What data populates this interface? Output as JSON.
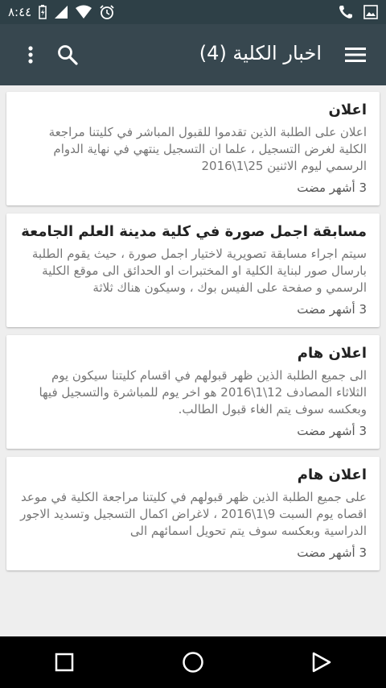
{
  "status_bar": {
    "time": "٨:٤٤",
    "icons": [
      "battery-icon",
      "signal-icon",
      "wifi-icon",
      "alarm-icon",
      "phone-icon",
      "image-icon"
    ]
  },
  "app_bar": {
    "title": "اخبار الكلية (4)",
    "icons": [
      "more-vert-icon",
      "search-icon",
      "hamburger-menu-icon"
    ]
  },
  "news": [
    {
      "title": "اعلان",
      "body": "اعلان على الطلبة الذين تقدموا للقبول المباشر في كليتنا مراجعة الكلية لغرض التسجيل ، علما ان التسجيل ينتهي في نهاية الدوام الرسمي ليوم الاثنين 25\\1\\2016",
      "time": "3 أشهر مضت"
    },
    {
      "title": "مسابقة اجمل صورة في كلية مدينة العلم الجامعة",
      "body": "سيتم اجراء مسابقة تصويرية لاختيار اجمل صورة ، حيث يقوم الطلبة بارسال صور لبناية الكلية او المختبرات او الحدائق الى موقع الكلية الرسمي و صفحة على الفيس بوك ، وسيكون هناك ثلاثة",
      "time": "3 أشهر مضت"
    },
    {
      "title": "اعلان هام",
      "body": "الى جميع الطلبة الذين ظهر قبولهم في اقسام كليتنا سيكون يوم الثلاثاء المصادف 12\\1\\2016 هو اخر يوم للمباشرة والتسجيل فيها وبعكسه سوف يتم الغاء قبول الطالب.",
      "time": "3 أشهر مضت"
    },
    {
      "title": "اعلان هام",
      "body": "على جميع الطلبة الذين ظهر قبولهم في كليتنا مراجعة الكلية في موعد اقصاه يوم السبت 9\\1\\2016 ، لاغراض اكمال التسجيل وتسديد الاجور الدراسية وبعكسه سوف يتم تحويل اسمائهم الى",
      "time": "3 أشهر مضت"
    }
  ],
  "nav_bar": {
    "icons": [
      "recents-square-icon",
      "home-circle-icon",
      "back-triangle-icon"
    ]
  },
  "colors": {
    "status_bar": "#2e4047",
    "app_bar": "#37474f",
    "background": "#eeeeee",
    "card": "#ffffff",
    "title_text": "#222222",
    "body_text": "#757575"
  }
}
